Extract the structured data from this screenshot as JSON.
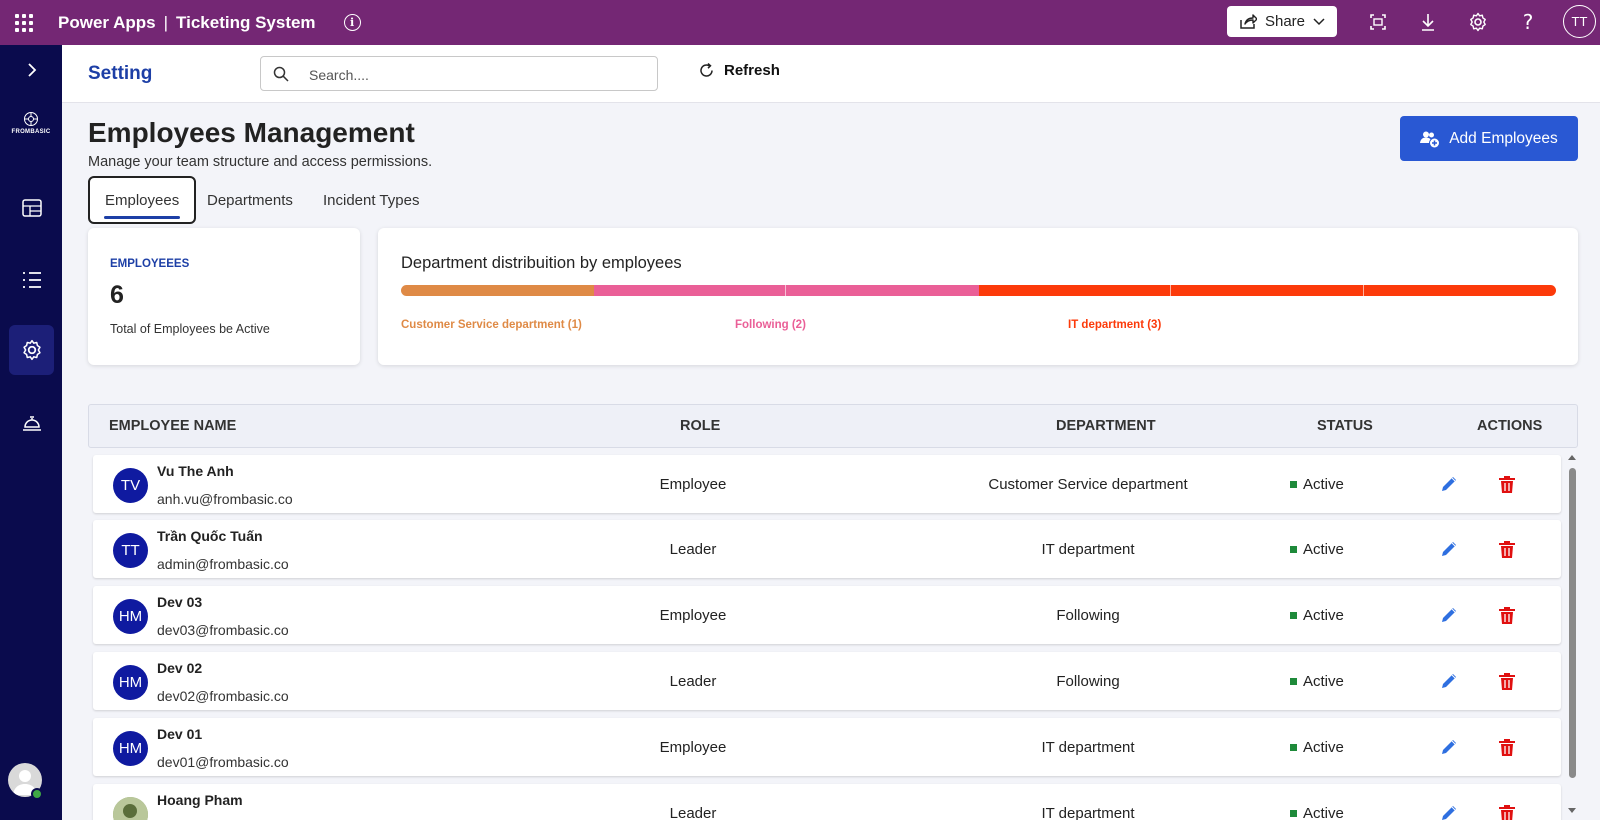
{
  "topbar": {
    "app_name": "Power Apps",
    "separator": "|",
    "app_title": "Ticketing System",
    "share_label": "Share",
    "user_initials": "TT"
  },
  "leftnav": {
    "logo_text": "FROMBASIC",
    "items": [
      "dashboard",
      "list",
      "settings",
      "service-bell"
    ],
    "active": "settings"
  },
  "header": {
    "page_name": "Setting",
    "search_placeholder": "Search....",
    "refresh_label": "Refresh"
  },
  "page": {
    "title": "Employees Management",
    "subtitle": "Manage your team structure and access permissions.",
    "add_button": "Add Employees"
  },
  "tabs": [
    {
      "label": "Employees",
      "active": true
    },
    {
      "label": "Departments",
      "active": false
    },
    {
      "label": "Incident Types",
      "active": false
    }
  ],
  "summary": {
    "label": "EMPLOYEEES",
    "count": "6",
    "description": "Total of Employees be Active"
  },
  "distribution": {
    "title": "Department distribuition by employees",
    "segments": [
      {
        "label": "Customer Service department (1)",
        "count": 1,
        "color": "#df8a46"
      },
      {
        "label": "Following (2)",
        "count": 2,
        "color": "#ea5f97"
      },
      {
        "label": "IT department (3)",
        "count": 3,
        "color": "#fc3a0a"
      }
    ]
  },
  "table": {
    "headers": {
      "name": "EMPLOYEE NAME",
      "role": "ROLE",
      "department": "DEPARTMENT",
      "status": "STATUS",
      "actions": "ACTIONS"
    },
    "rows": [
      {
        "initials": "TV",
        "name": "Vu The Anh",
        "email": "anh.vu@frombasic.co",
        "role": "Employee",
        "department": "Customer Service department",
        "status": "Active"
      },
      {
        "initials": "TT",
        "name": "Trần Quốc Tuấn",
        "email": "admin@frombasic.co",
        "role": "Leader",
        "department": "IT department",
        "status": "Active"
      },
      {
        "initials": "HM",
        "name": "Dev 03",
        "email": "dev03@frombasic.co",
        "role": "Employee",
        "department": "Following",
        "status": "Active"
      },
      {
        "initials": "HM",
        "name": "Dev 02",
        "email": "dev02@frombasic.co",
        "role": "Leader",
        "department": "Following",
        "status": "Active"
      },
      {
        "initials": "HM",
        "name": "Dev 01",
        "email": "dev01@frombasic.co",
        "role": "Employee",
        "department": "IT department",
        "status": "Active"
      },
      {
        "initials": "",
        "name": "Hoang Pham",
        "email": "",
        "role": "Leader",
        "department": "IT department",
        "status": "Active"
      }
    ]
  },
  "colors": {
    "topbar": "#742774",
    "leftnav": "#0a0b4d",
    "accent": "#2958d3",
    "title_blue": "#1d3fa6",
    "status_active": "#1e8a3a",
    "delete_red": "#e01010",
    "edit_blue": "#2e6fe0"
  }
}
